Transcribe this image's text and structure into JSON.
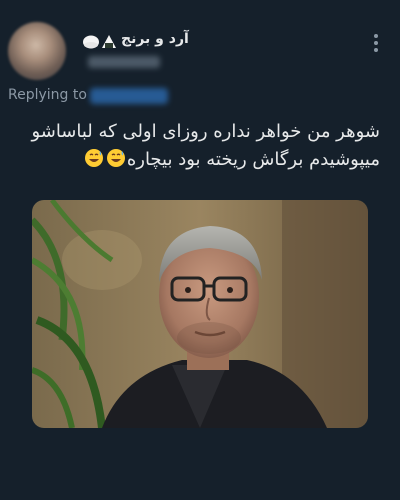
{
  "tweet": {
    "author": {
      "display_name": "آرد و برنج",
      "name_emojis": [
        "rice-ball-emoji",
        "rice-ball-emoji"
      ],
      "avatar": "avatar-image"
    },
    "replying_to_label": "Replying to",
    "text_line_1": "شوهر من خواهر نداره روزای اولی که لباساشو",
    "text_line_2": "میپوشیدم برگاش ریخته بود بیچاره",
    "text_emojis": [
      "grinning-sweat-emoji",
      "grinning-sweat-emoji"
    ],
    "more_icon": "more-vertical-icon",
    "media": {
      "kind": "photo",
      "description_icon": "man-with-glasses-photo"
    }
  },
  "colors": {
    "background": "#15202b",
    "text": "#e7e9ea",
    "secondary": "#8b98a5",
    "link": "#1d9bf0"
  }
}
